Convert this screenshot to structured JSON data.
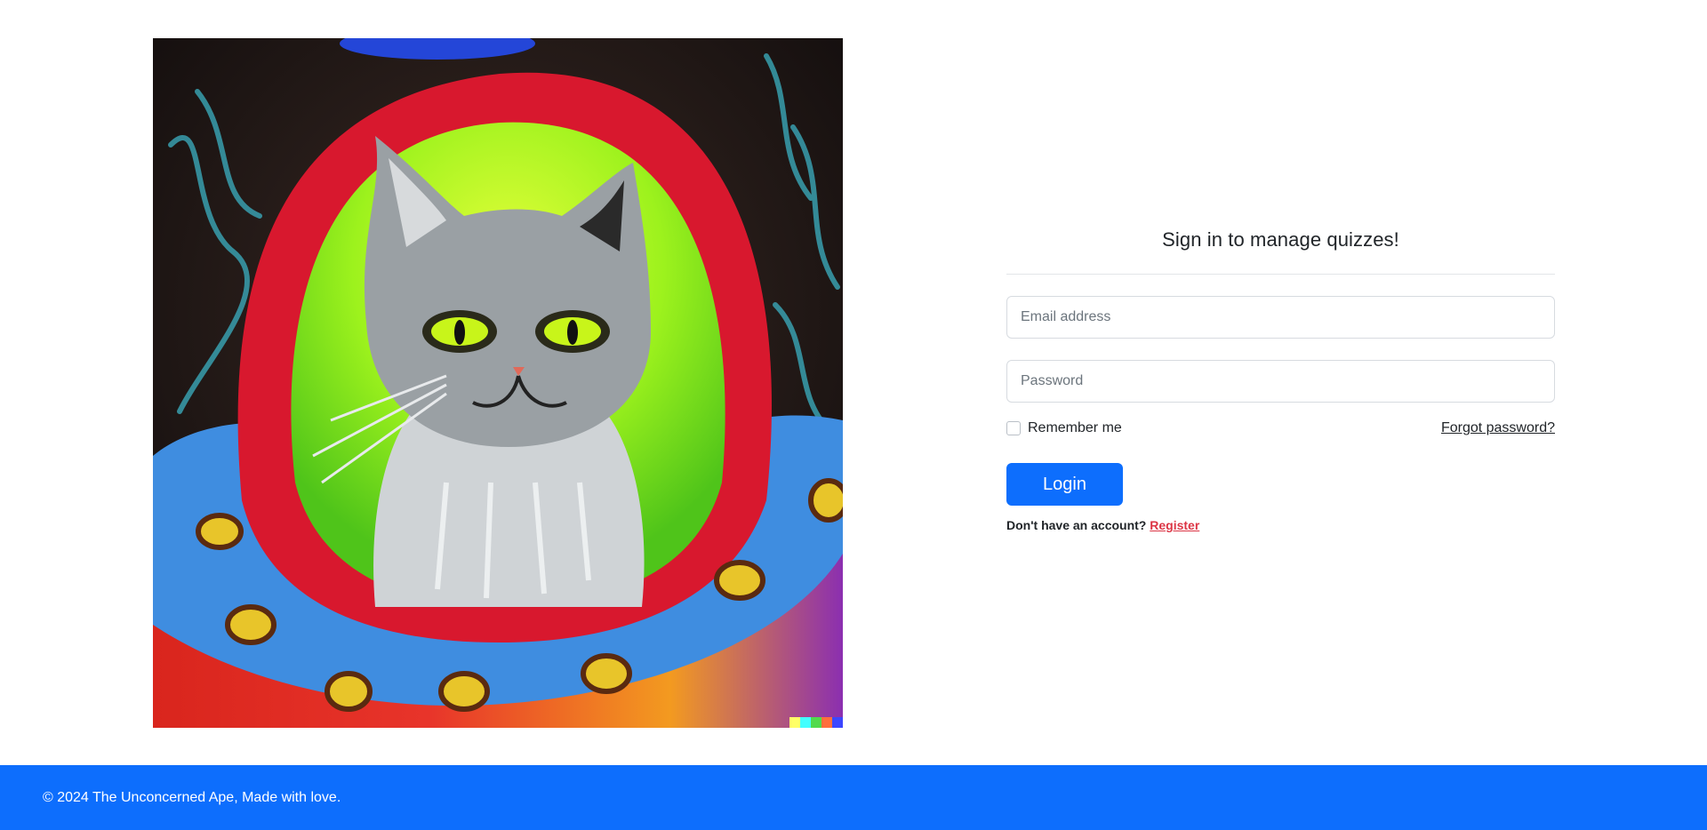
{
  "hero": {
    "image_alt": "Painting of a grey cat in a flying saucer",
    "icon": "cat-spaceship-illustration"
  },
  "login": {
    "heading": "Sign in to manage quizzes!",
    "email_placeholder": "Email address",
    "password_placeholder": "Password",
    "remember_label": "Remember me",
    "forgot_label": "Forgot password?",
    "login_label": "Login",
    "no_account_text": "Don't have an account?",
    "register_label": "Register"
  },
  "footer": {
    "text": "© 2024 The Unconcerned Ape, Made with love."
  },
  "colors": {
    "primary": "#0d6efd",
    "register_link": "#dc3545",
    "footer_bg": "#0d6efd"
  }
}
